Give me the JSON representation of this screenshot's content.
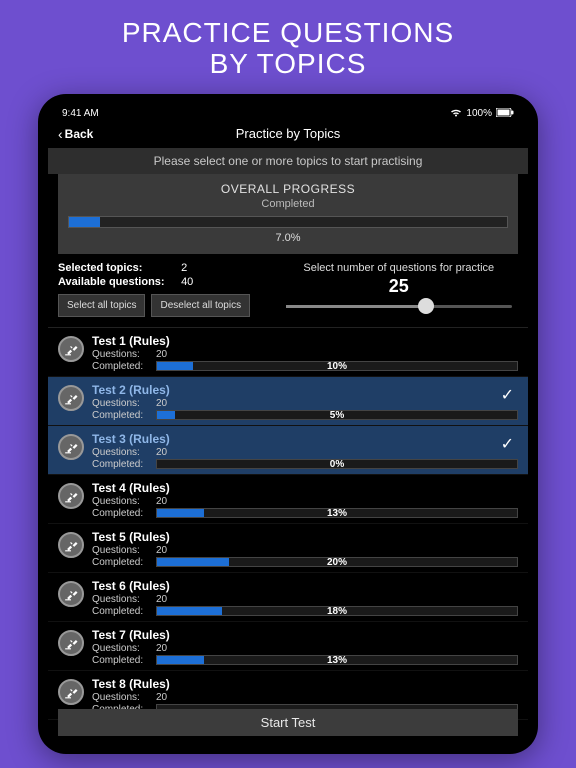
{
  "promo": {
    "line1": "PRACTICE QUESTIONS",
    "line2": "BY TOPICS"
  },
  "status": {
    "time": "9:41 AM",
    "battery": "100%"
  },
  "nav": {
    "back": "Back",
    "title": "Practice by Topics"
  },
  "instruction": "Please select one or more topics to start practising",
  "overall": {
    "heading": "OVERALL PROGRESS",
    "sub": "Completed",
    "percent_label": "7.0%",
    "percent": 7
  },
  "info": {
    "selected_label": "Selected topics:",
    "selected_value": "2",
    "available_label": "Available questions:",
    "available_value": "40",
    "select_all": "Select all topics",
    "deselect_all": "Deselect all topics"
  },
  "slider": {
    "label": "Select number of questions for practice",
    "value": "25",
    "percent": 62
  },
  "topics": [
    {
      "title": "Test 1 (Rules)",
      "q": "20",
      "pct": 10,
      "pct_label": "10%",
      "selected": false
    },
    {
      "title": "Test 2 (Rules)",
      "q": "20",
      "pct": 5,
      "pct_label": "5%",
      "selected": true
    },
    {
      "title": "Test 3 (Rules)",
      "q": "20",
      "pct": 0,
      "pct_label": "0%",
      "selected": true
    },
    {
      "title": "Test 4 (Rules)",
      "q": "20",
      "pct": 13,
      "pct_label": "13%",
      "selected": false
    },
    {
      "title": "Test 5 (Rules)",
      "q": "20",
      "pct": 20,
      "pct_label": "20%",
      "selected": false
    },
    {
      "title": "Test 6 (Rules)",
      "q": "20",
      "pct": 18,
      "pct_label": "18%",
      "selected": false
    },
    {
      "title": "Test 7 (Rules)",
      "q": "20",
      "pct": 13,
      "pct_label": "13%",
      "selected": false
    },
    {
      "title": "Test 8 (Rules)",
      "q": "20",
      "pct": 0,
      "pct_label": "",
      "selected": false
    }
  ],
  "labels": {
    "questions": "Questions:",
    "completed": "Completed:"
  },
  "start": "Start Test"
}
